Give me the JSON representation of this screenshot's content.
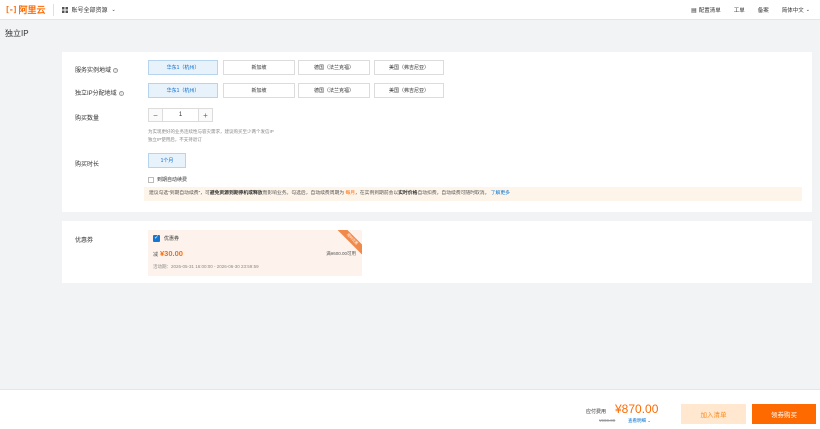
{
  "header": {
    "logo_mark": "[-]",
    "logo_text": "阿里云",
    "resource_selector": "账号全部资源",
    "right_items": [
      {
        "icon": "document-icon",
        "label": "配置清单"
      },
      {
        "label": "工单"
      },
      {
        "label": "备案"
      },
      {
        "label": "简体中文"
      }
    ]
  },
  "page": {
    "title": "独立IP"
  },
  "form": {
    "service_region": {
      "label": "服务实例地域",
      "options": [
        "华东1（杭州）",
        "新加坡",
        "德国（法兰克福）",
        "美国（弗吉尼亚）"
      ],
      "selected_index": 0
    },
    "ip_region": {
      "label": "独立IP分配地域",
      "options": [
        "华东1（杭州）",
        "新加坡",
        "德国（法兰克福）",
        "美国（弗吉尼亚）"
      ],
      "selected_index": 0
    },
    "quantity": {
      "label": "购买数量",
      "value": "1",
      "minus": "−",
      "plus": "+",
      "hint1": "为实现更好的业务连续性与容灾需求，建议购买至少两个发信IP",
      "hint2": "独立IP使用后，不支持退订"
    },
    "duration": {
      "label": "购买时长",
      "options": [
        "1个月"
      ],
      "selected_index": 0
    },
    "auto_renew": {
      "label": "到期自动续费",
      "checked": false
    },
    "notice": {
      "p1": "建议勾选“到期自动续费”，可",
      "b1": "避免资源到期停机或释放",
      "p2": "而影响业务。勾选后，自动续费周期为 ",
      "hl": "每月",
      "p3": "，在实例到期前会以",
      "b2": "实时价格",
      "p4": "自动扣费，自动续费可随时取消。",
      "link": "了解更多"
    }
  },
  "coupons": {
    "label": "优惠券",
    "card": {
      "name": "优惠券",
      "checked": true,
      "prefix": "减",
      "amount": "¥30.00",
      "condition": "满¥600.00可用",
      "time": "活动期：2026-05-31 16:00:00 - 2026-06-30 23:59:59",
      "ribbon": "限时优惠"
    }
  },
  "footer": {
    "price_label": "应付费用",
    "price": "¥870.00",
    "original": "¥900.00",
    "detail": "查看明细",
    "cart_button": "加入清单",
    "buy_button": "领券购买"
  },
  "colors": {
    "brand": "#ff6a00",
    "link": "#0070cc",
    "selected_bg": "#e8f2fb",
    "checkbox": "#1677d2"
  }
}
